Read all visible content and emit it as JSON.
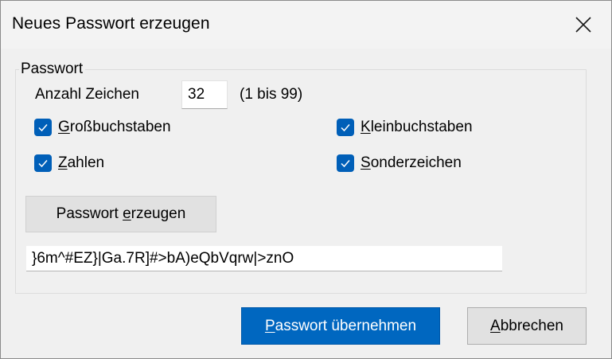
{
  "window": {
    "title": "Neues Passwort erzeugen",
    "close_icon": "close-icon"
  },
  "group": {
    "legend": "Passwort",
    "length_label": "Anzahl Zeichen",
    "length_value": "32",
    "length_range": "(1 bis 99)"
  },
  "options": {
    "uppercase": {
      "label_accel": "G",
      "label_rest": "roßbuchstaben",
      "checked": true
    },
    "lowercase": {
      "label_accel": "K",
      "label_rest": "leinbuchstaben",
      "checked": true
    },
    "digits": {
      "label_accel": "Z",
      "label_rest": "ahlen",
      "checked": true
    },
    "special": {
      "label_accel": "S",
      "label_rest": "onderzeichen",
      "checked": true
    }
  },
  "generate_button": {
    "label_pre": "Passwort ",
    "label_accel": "e",
    "label_post": "rzeugen"
  },
  "password_output": "}6m^#EZ}|Ga.7R]#>bA)eQbVqrw|>znO",
  "footer": {
    "ok_label_accel": "P",
    "ok_label_rest": "asswort übernehmen",
    "cancel_label_accel": "A",
    "cancel_label_rest": "bbrechen"
  },
  "colors": {
    "accent": "#0067c0",
    "checkbox": "#005fb8",
    "background": "#f0f0f0"
  }
}
